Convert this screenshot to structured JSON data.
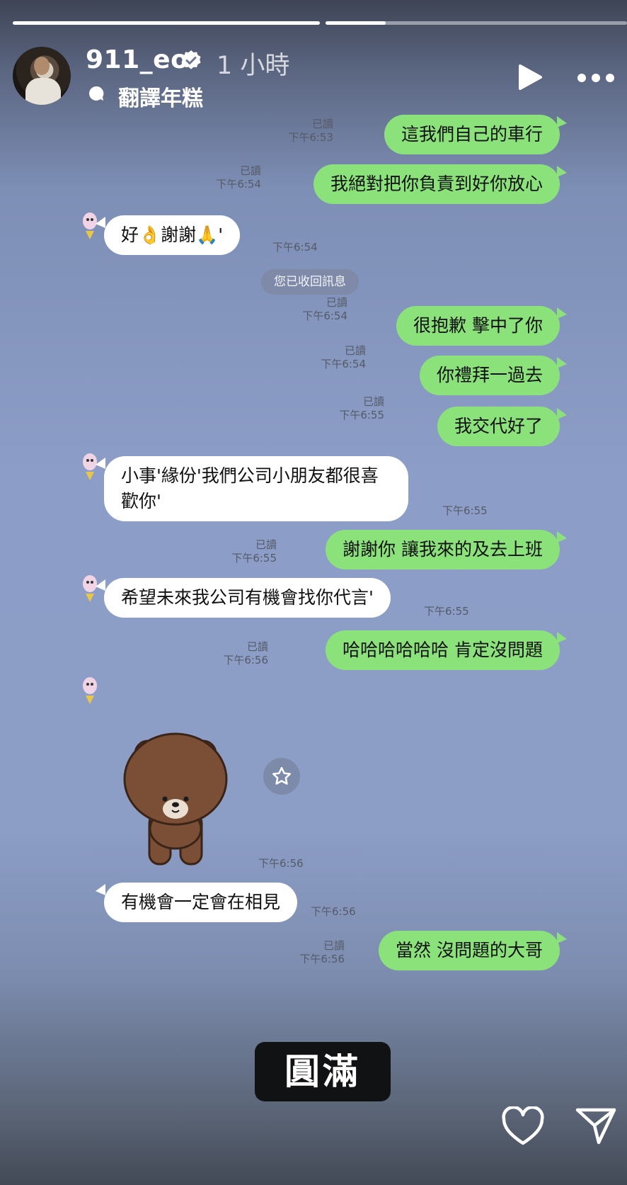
{
  "story": {
    "username": "911_eo",
    "time_ago": "1 小時",
    "audio_label": "翻譯年糕",
    "progress_segments": [
      1.0,
      0.2
    ]
  },
  "chat": {
    "messages": [
      {
        "dir": "out",
        "text": "這我們自己的車行",
        "read": "已讀",
        "time": "下午6:53"
      },
      {
        "dir": "out",
        "text": "我絕對把你負責到好你放心",
        "read": "已讀",
        "time": "下午6:54"
      },
      {
        "dir": "in",
        "text": "好👌謝謝🙏'",
        "time": "下午6:54"
      },
      {
        "dir": "out",
        "text": "很抱歉 擊中了你",
        "read": "已讀",
        "time": "下午6:54"
      },
      {
        "dir": "out",
        "text": "你禮拜一過去",
        "read": "已讀",
        "time": "下午6:54"
      },
      {
        "dir": "out",
        "text": "我交代好了",
        "read": "已讀",
        "time": "下午6:55"
      },
      {
        "dir": "in",
        "text_line1": "小事'緣份'我們公司小朋友都很喜",
        "text_line2": "歡你'",
        "time": "下午6:55"
      },
      {
        "dir": "out",
        "text": "謝謝你 讓我來的及去上班",
        "read": "已讀",
        "time": "下午6:55"
      },
      {
        "dir": "in",
        "text": "希望未來我公司有機會找你代言'",
        "time": "下午6:55"
      },
      {
        "dir": "out",
        "text": "哈哈哈哈哈哈 肯定沒問題",
        "read": "已讀",
        "time": "下午6:56"
      },
      {
        "dir": "in",
        "sticker": "brown-bear",
        "time": "下午6:56"
      },
      {
        "dir": "in",
        "text": "有機會一定會在相見",
        "time": "下午6:56"
      },
      {
        "dir": "out",
        "text": "當然 沒問題的大哥",
        "read": "已讀",
        "time": "下午6:56"
      }
    ],
    "system_message": "您已收回訊息"
  },
  "caption": "圓滿",
  "icons": {
    "verified": "verified-badge-icon",
    "audio": "audio-wave-icon",
    "play": "play-icon",
    "more": "more-options-icon",
    "favorite": "star-icon",
    "like": "heart-icon",
    "share": "send-icon"
  },
  "colors": {
    "outgoing_bubble": "#8ce27a",
    "incoming_bubble": "#ffffff",
    "chat_background": "#8c9dc7"
  }
}
